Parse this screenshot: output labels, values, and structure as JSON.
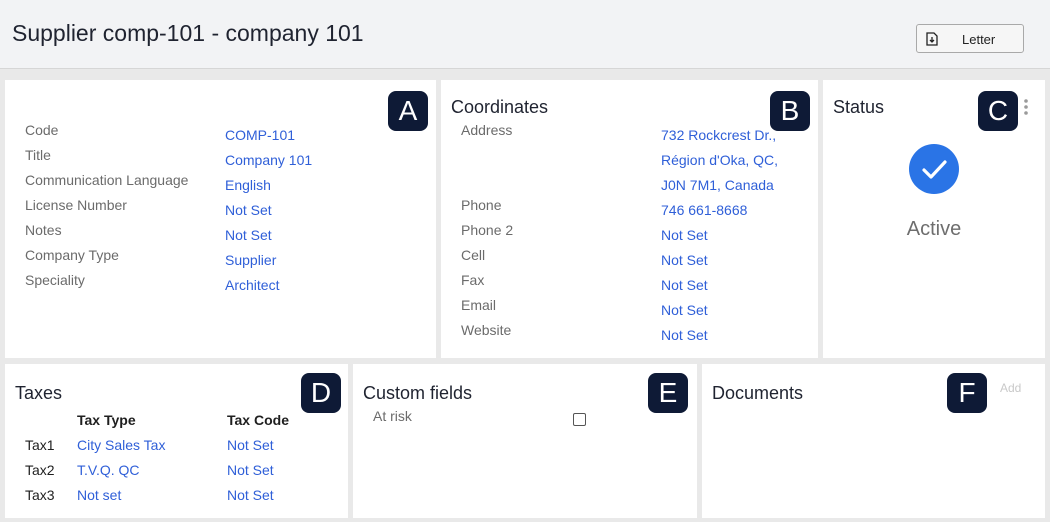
{
  "header": {
    "title": "Supplier comp-101 - company 101",
    "letter_label": "Letter"
  },
  "card_a": {
    "badge": "A",
    "fields": [
      {
        "label": "Code",
        "value": "COMP-101"
      },
      {
        "label": "Title",
        "value": "Company 101"
      },
      {
        "label": "Communication Language",
        "value": "English"
      },
      {
        "label": "License Number",
        "value": "Not Set"
      },
      {
        "label": "Notes",
        "value": "Not Set"
      },
      {
        "label": "Company Type",
        "value": "Supplier"
      },
      {
        "label": "Speciality",
        "value": "Architect"
      }
    ]
  },
  "card_b": {
    "title": "Coordinates",
    "badge": "B",
    "address_label": "Address",
    "address_lines": [
      "732 Rockcrest Dr.,",
      "Région d'Oka, QC,",
      "J0N 7M1, Canada"
    ],
    "fields": [
      {
        "label": "Phone",
        "value": "746 661-8668"
      },
      {
        "label": "Phone 2",
        "value": "Not Set"
      },
      {
        "label": "Cell",
        "value": "Not Set"
      },
      {
        "label": "Fax",
        "value": "Not Set"
      },
      {
        "label": "Email",
        "value": "Not Set"
      },
      {
        "label": "Website",
        "value": "Not Set"
      }
    ]
  },
  "card_c": {
    "title": "Status",
    "badge": "C",
    "status": "Active",
    "status_color": "#2a74e6"
  },
  "card_d": {
    "title": "Taxes",
    "badge": "D",
    "col_type": "Tax Type",
    "col_code": "Tax Code",
    "rows": [
      {
        "name": "Tax1",
        "type": "City Sales Tax",
        "code": "Not Set"
      },
      {
        "name": "Tax2",
        "type": "T.V.Q. QC",
        "code": "Not Set"
      },
      {
        "name": "Tax3",
        "type": "Not set",
        "code": "Not Set"
      }
    ]
  },
  "card_e": {
    "title": "Custom fields",
    "badge": "E",
    "field_label": "At risk"
  },
  "card_f": {
    "title": "Documents",
    "badge": "F",
    "add_label": "Add"
  },
  "colors": {
    "link": "#2f5fd8",
    "badge": "#0e1a36"
  }
}
